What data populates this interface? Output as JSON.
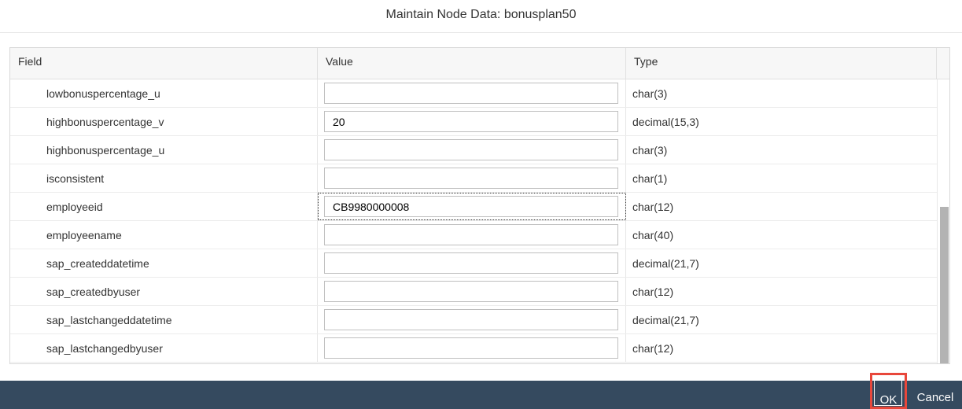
{
  "dialog": {
    "title": "Maintain Node Data: bonusplan50"
  },
  "table": {
    "columns": [
      "Field",
      "Value",
      "Type"
    ],
    "rows": [
      {
        "field": "lowbonuspercentage_u",
        "value": "",
        "type": "char(3)"
      },
      {
        "field": "highbonuspercentage_v",
        "value": "20",
        "type": "decimal(15,3)"
      },
      {
        "field": "highbonuspercentage_u",
        "value": "",
        "type": "char(3)"
      },
      {
        "field": "isconsistent",
        "value": "",
        "type": "char(1)"
      },
      {
        "field": "employeeid",
        "value": "CB9980000008",
        "type": "char(12)"
      },
      {
        "field": "employeename",
        "value": "",
        "type": "char(40)"
      },
      {
        "field": "sap_createddatetime",
        "value": "",
        "type": "decimal(21,7)"
      },
      {
        "field": "sap_createdbyuser",
        "value": "",
        "type": "char(12)"
      },
      {
        "field": "sap_lastchangeddatetime",
        "value": "",
        "type": "decimal(21,7)"
      },
      {
        "field": "sap_lastchangedbyuser",
        "value": "",
        "type": "char(12)"
      }
    ],
    "focused_row": 4
  },
  "footer": {
    "ok_label": "OK",
    "cancel_label": "Cancel"
  },
  "colors": {
    "footer_bg": "#354a5f",
    "highlight_frame": "#e8473b"
  }
}
